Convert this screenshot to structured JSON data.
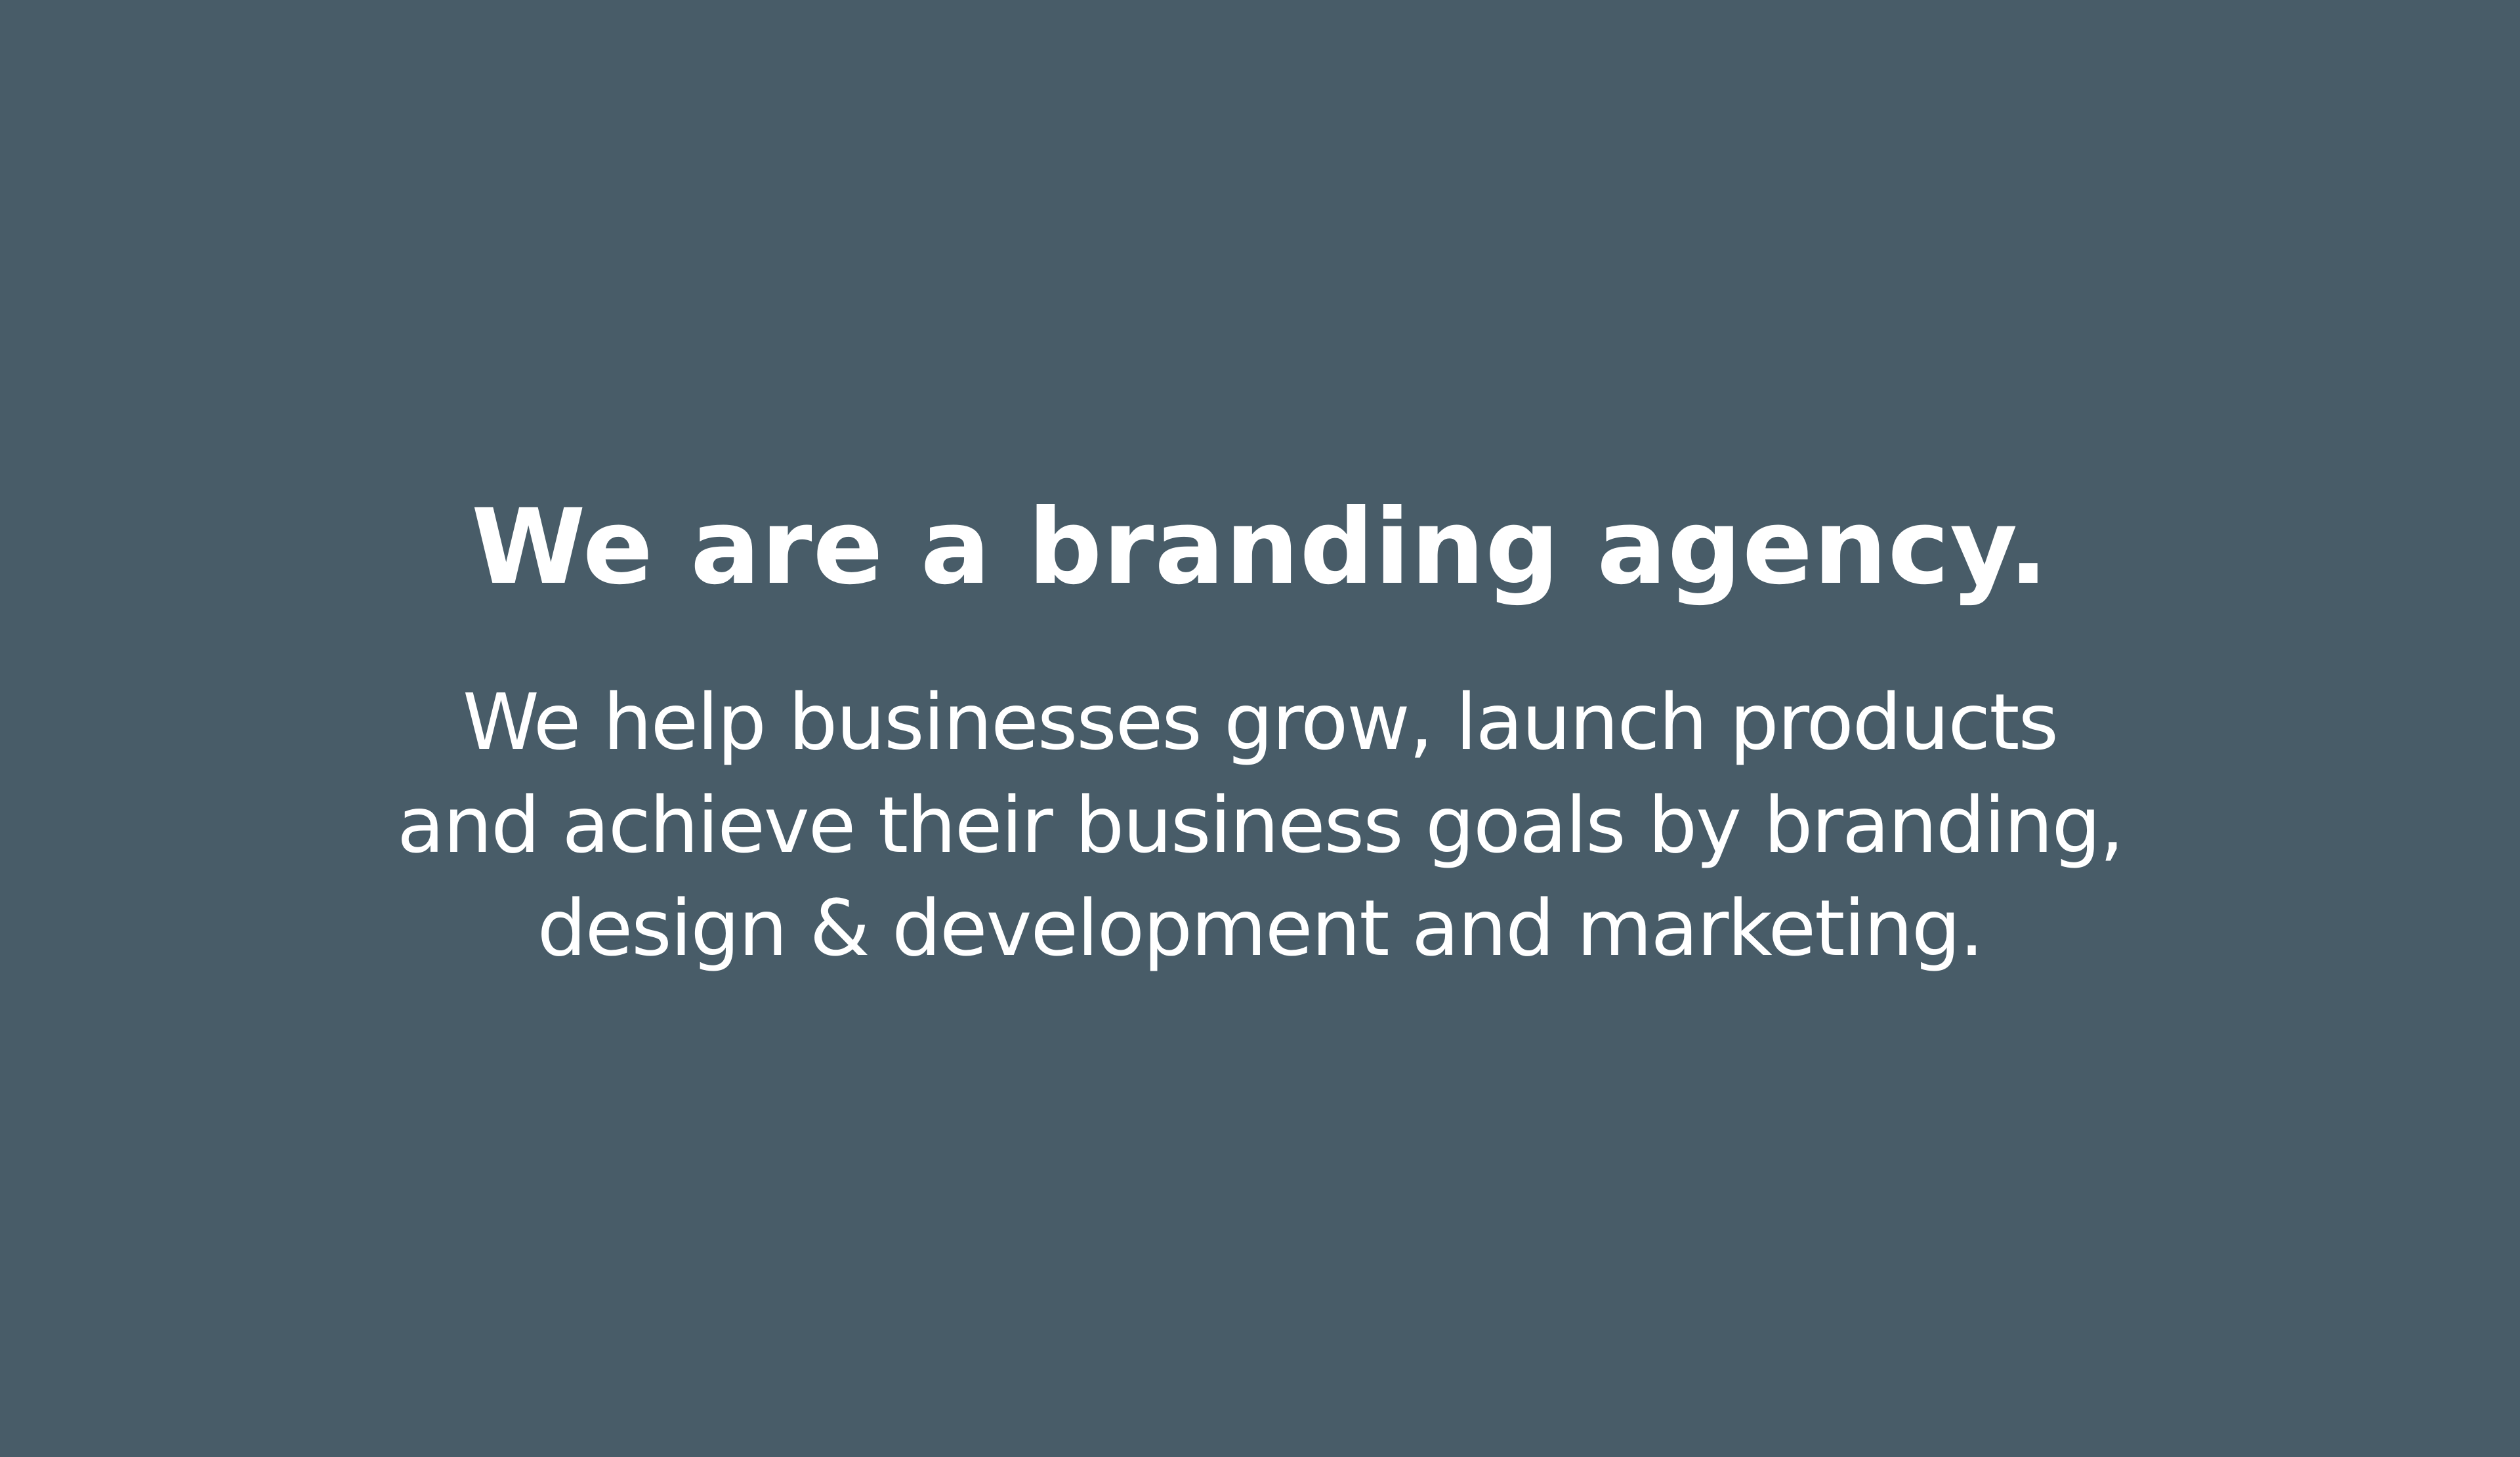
{
  "hero": {
    "headline": "We are a branding agency.",
    "lines": [
      "We help businesses grow, launch products",
      "and achieve their business goals by branding,",
      "design & development and marketing."
    ]
  },
  "colors": {
    "background": "#485c68",
    "text": "#ffffff"
  }
}
